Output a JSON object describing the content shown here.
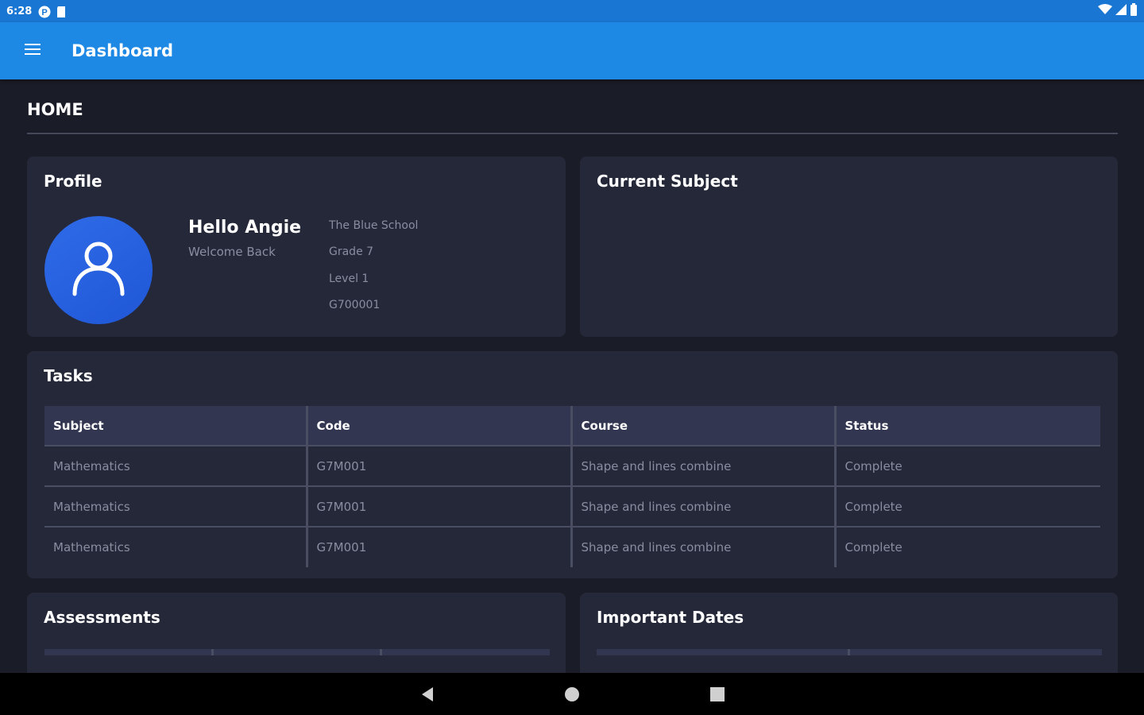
{
  "status_bar": {
    "time": "6:28"
  },
  "app_bar": {
    "title": "Dashboard"
  },
  "page": {
    "heading": "HOME"
  },
  "profile_card": {
    "title": "Profile",
    "greeting": "Hello Angie",
    "subtitle": "Welcome Back",
    "details": [
      "The Blue School",
      "Grade 7",
      "Level 1",
      "G700001"
    ]
  },
  "current_subject_card": {
    "title": "Current Subject"
  },
  "tasks_card": {
    "title": "Tasks",
    "columns": [
      "Subject",
      "Code",
      "Course",
      "Status"
    ],
    "rows": [
      [
        "Mathematics",
        "G7M001",
        "Shape and lines combine",
        "Complete"
      ],
      [
        "Mathematics",
        "G7M001",
        "Shape and lines combine",
        "Complete"
      ],
      [
        "Mathematics",
        "G7M001",
        "Shape and lines combine",
        "Complete"
      ]
    ]
  },
  "assessments_card": {
    "title": "Assessments"
  },
  "important_dates_card": {
    "title": "Important Dates"
  },
  "colors": {
    "app_bar": "#1e88e5",
    "status_bar": "#1976d2",
    "background": "#1a1c27",
    "card": "#252839",
    "avatar": "#2f6be8"
  },
  "icons": {
    "menu": "hamburger-menu-icon",
    "avatar": "user-outline-icon",
    "nav_back": "triangle-back-icon",
    "nav_home": "circle-home-icon",
    "nav_recents": "square-recents-icon"
  }
}
